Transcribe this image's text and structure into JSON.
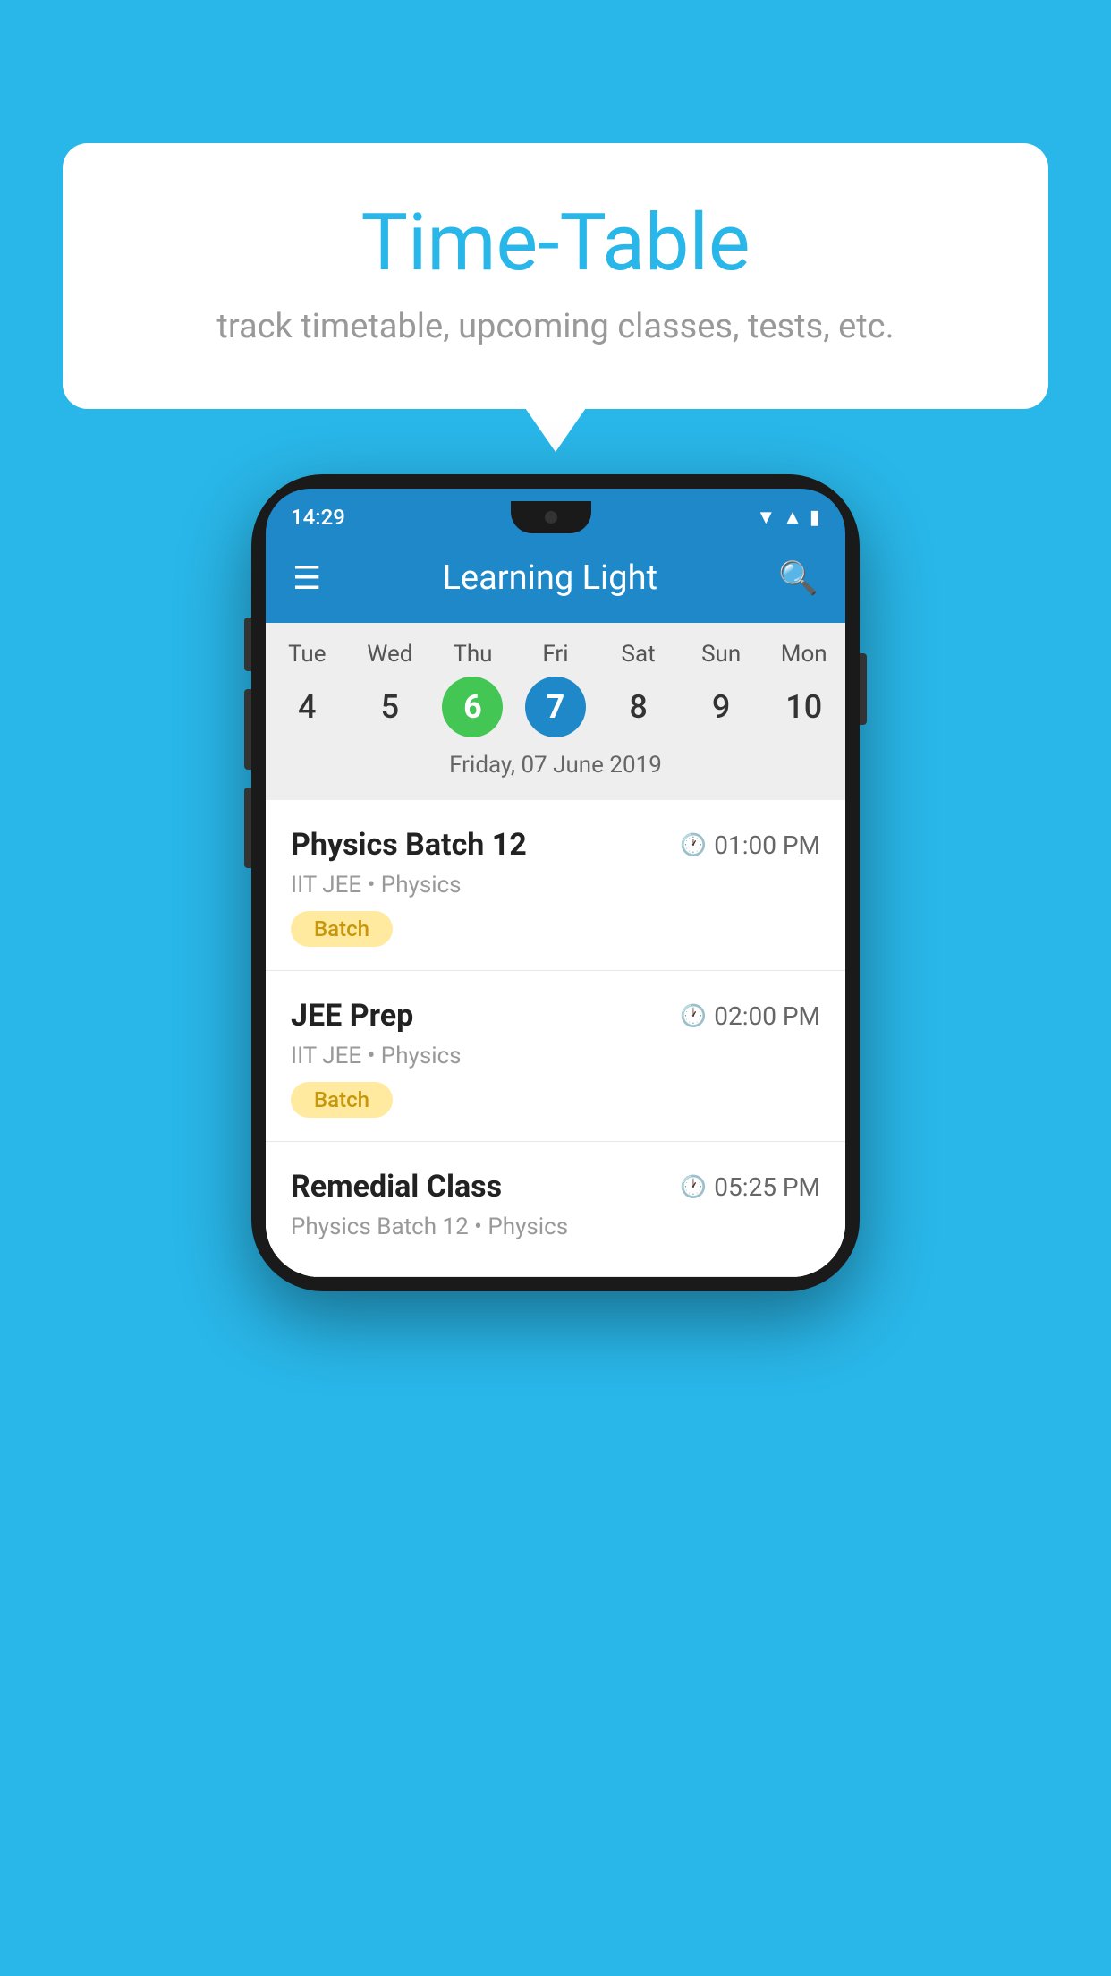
{
  "background_color": "#29b6e8",
  "bubble": {
    "title": "Time-Table",
    "subtitle": "track timetable, upcoming classes, tests, etc."
  },
  "phone": {
    "status_bar": {
      "time": "14:29"
    },
    "app_bar": {
      "title": "Learning Light"
    },
    "calendar": {
      "days": [
        {
          "short": "Tue",
          "num": "4"
        },
        {
          "short": "Wed",
          "num": "5"
        },
        {
          "short": "Thu",
          "num": "6",
          "state": "today"
        },
        {
          "short": "Fri",
          "num": "7",
          "state": "selected"
        },
        {
          "short": "Sat",
          "num": "8"
        },
        {
          "short": "Sun",
          "num": "9"
        },
        {
          "short": "Mon",
          "num": "10"
        }
      ],
      "selected_date_label": "Friday, 07 June 2019"
    },
    "schedule": [
      {
        "title": "Physics Batch 12",
        "time": "01:00 PM",
        "subtitle": "IIT JEE • Physics",
        "tag": "Batch"
      },
      {
        "title": "JEE Prep",
        "time": "02:00 PM",
        "subtitle": "IIT JEE • Physics",
        "tag": "Batch"
      },
      {
        "title": "Remedial Class",
        "time": "05:25 PM",
        "subtitle": "Physics Batch 12 • Physics",
        "tag": null
      }
    ]
  }
}
